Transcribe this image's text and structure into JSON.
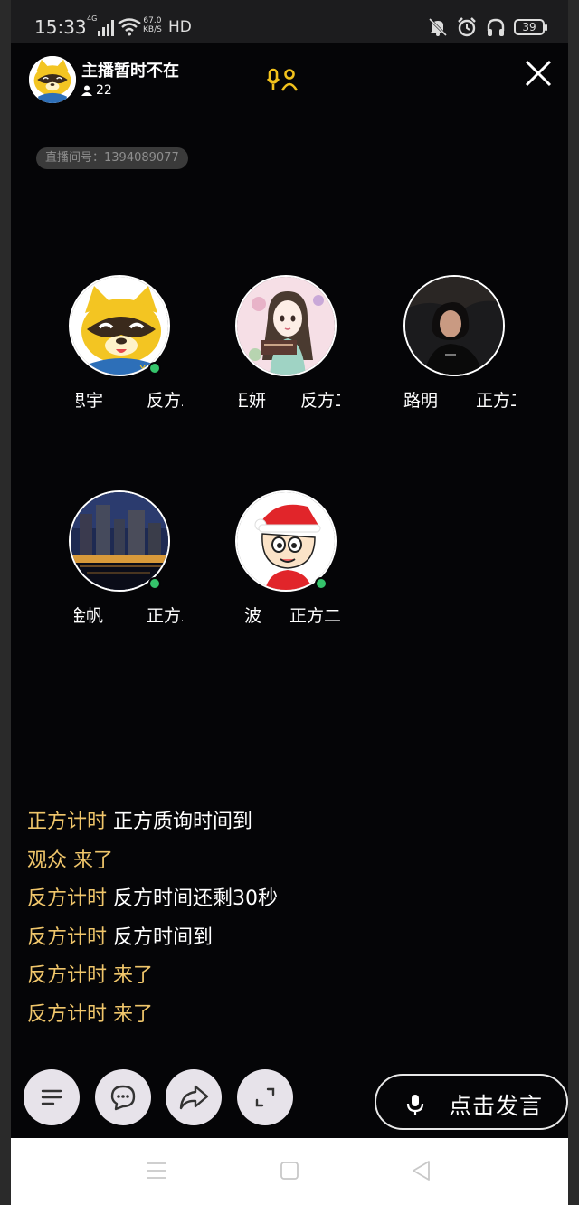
{
  "status_bar": {
    "time": "15:33",
    "network": "4G",
    "speed": "67.0",
    "speed_unit": "KB/S",
    "hd": "HD",
    "battery": "39"
  },
  "header": {
    "host_name": "主播暂时不在",
    "viewer_count": "22",
    "room_id_label": "直播间号：1394089077"
  },
  "seats": [
    {
      "name": "思宇",
      "side": "反方二",
      "online": true,
      "avatar": "raccoon-mascot"
    },
    {
      "name": "王妍",
      "side": "反方二",
      "online": false,
      "avatar": "anime-girl"
    },
    {
      "name": "路明",
      "side": "正方二",
      "online": false,
      "avatar": "photo-person"
    },
    {
      "name": "金帆",
      "side": "正方二",
      "online": true,
      "avatar": "night-city"
    },
    {
      "name": "波",
      "side": "正方二",
      "online": true,
      "avatar": "cartoon-boy"
    }
  ],
  "chat": {
    "messages": [
      {
        "who": "正方计时",
        "msg": "正方质询时间到",
        "msg_gold": false
      },
      {
        "who": "观众",
        "msg": "来了",
        "msg_gold": true
      },
      {
        "who": "反方计时",
        "msg": "反方时间还剩30秒",
        "msg_gold": false
      },
      {
        "who": "反方计时",
        "msg": "反方时间到",
        "msg_gold": false
      },
      {
        "who": "反方计时",
        "msg": "来了",
        "msg_gold": true
      },
      {
        "who": "反方计时",
        "msg": "来了",
        "msg_gold": true
      }
    ]
  },
  "controls": {
    "speak_label": "点击发言"
  },
  "colors": {
    "accent_gold": "#f0c66b",
    "online_green": "#35c46b",
    "background": "#050507"
  }
}
